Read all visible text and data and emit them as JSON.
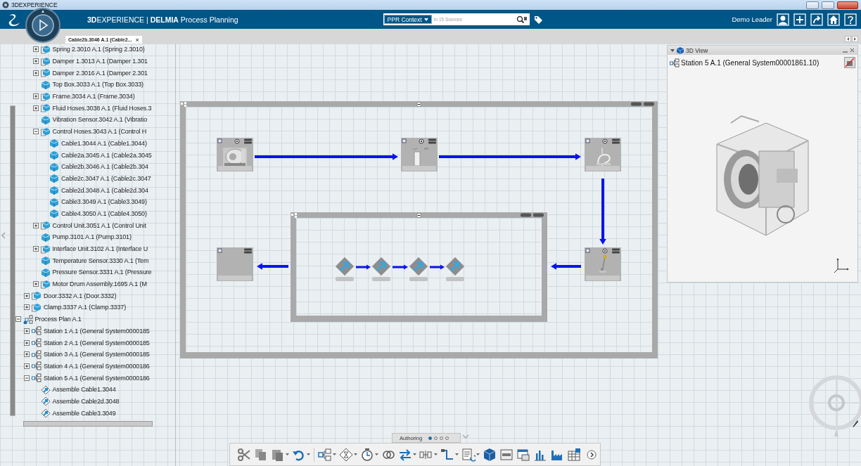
{
  "window": {
    "title": "3DEXPERIENCE"
  },
  "header": {
    "brand": "**3D**EXPERIENCE | **DELMIA** Process Planning",
    "search": {
      "context": "PPR Context",
      "placeholder": "In 15 Sources"
    },
    "user": "Demo Leader"
  },
  "tabs": [
    {
      "label": "Cable2b.3046 A.1 (Cable2...",
      "close": "×",
      "selected": true
    }
  ],
  "tree": {
    "items": [
      {
        "children": [
          {
            "children": [
              {
                "label": "Spring 2.3010 A.1 (Spring 2.3010)",
                "kind": "assembly",
                "expanded": false
              },
              {
                "label": "Damper 1.3013 A.1 (Damper 1.301",
                "kind": "assembly",
                "expanded": false
              },
              {
                "label": "Damper 2.3016 A.1 (Damper 2.301",
                "kind": "assembly",
                "expanded": false
              },
              {
                "label": "Top Box.3033 A.1 (Top Box.3033)",
                "kind": "part"
              },
              {
                "label": "Frame.3034 A.1 (Frame.3034)",
                "kind": "assembly",
                "expanded": false
              },
              {
                "label": "Fluid Hoses.3038 A.1 (Fluid Hoses.3",
                "kind": "assembly",
                "expanded": false
              },
              {
                "label": "Vibration Sensor.3042 A.1 (Vibratio",
                "kind": "part"
              },
              {
                "label": "Control Hoses.3043 A.1 (Control H",
                "kind": "assembly",
                "expanded": true,
                "children": [
                  {
                    "label": "Cable1.3044 A.1 (Cable1.3044)",
                    "kind": "part"
                  },
                  {
                    "label": "Cable2a.3045 A.1 (Cable2a.3045",
                    "kind": "part"
                  },
                  {
                    "label": "Cable2b.3046 A.1 (Cable2b.304",
                    "kind": "part"
                  },
                  {
                    "label": "Cable2c.3047 A.1 (Cable2c.3047",
                    "kind": "part"
                  },
                  {
                    "label": "Cable2d.3048 A.1 (Cable2d.304",
                    "kind": "part"
                  },
                  {
                    "label": "Cable3.3049 A.1 (Cable3.3049)",
                    "kind": "part"
                  },
                  {
                    "label": "Cable4.3050 A.1 (Cable4.3050)",
                    "kind": "part"
                  }
                ]
              },
              {
                "label": "Control Unit.3051 A.1 (Control Unit",
                "kind": "assembly",
                "expanded": false
              },
              {
                "label": "Pump.3101 A.1 (Pump.3101)",
                "kind": "part"
              },
              {
                "label": "Interface Unit.3102 A.1 (Interface U",
                "kind": "assembly",
                "expanded": false
              },
              {
                "label": "Temperature Sensor.3330 A.1 (Tem",
                "kind": "part"
              },
              {
                "label": "Pressure Sensor.3331 A.1 (Pressure",
                "kind": "part"
              },
              {
                "label": "Motor Drum Assembly.1695 A.1 (M",
                "kind": "assembly",
                "expanded": false
              }
            ]
          },
          {
            "label": "Door.3332 A.1 (Door.3332)",
            "kind": "assembly",
            "expanded": false
          },
          {
            "label": "Clamp.3337 A.1 (Clamp.3337)",
            "kind": "assembly",
            "expanded": false
          }
        ]
      },
      {
        "label": "Process Plan A.1",
        "kind": "plan",
        "expanded": true,
        "children": [
          {
            "label": "Station 1 A.1 (General System0000185",
            "kind": "system",
            "expanded": false
          },
          {
            "label": "Station 2 A.1 (General System0000185",
            "kind": "system",
            "expanded": false
          },
          {
            "label": "Station 3 A.1 (General System0000185",
            "kind": "system",
            "expanded": false
          },
          {
            "label": "Station 4 A.1 (General System0000186",
            "kind": "system",
            "expanded": false
          },
          {
            "label": "Station 5 A.1 (General System0000186",
            "kind": "system",
            "expanded": true,
            "children": [
              {
                "label": "Assemble Cable1.3044",
                "kind": "operation"
              },
              {
                "label": "Assemble Cable2d.3048",
                "kind": "operation"
              },
              {
                "label": "Assemble Cable3.3049",
                "kind": "operation"
              }
            ]
          }
        ]
      }
    ]
  },
  "diagram": {
    "stations": [
      {
        "kind": "picture"
      },
      {
        "kind": "picture"
      },
      {
        "kind": "picture"
      },
      {
        "kind": "picture"
      },
      {
        "kind": "empty"
      }
    ],
    "operations": [
      {
        "kind": "operation"
      },
      {
        "kind": "operation"
      },
      {
        "kind": "operation"
      },
      {
        "kind": "operation"
      }
    ]
  },
  "view_panel": {
    "title": "3D View",
    "item": "Station 5 A.1 (General System00001861.10)",
    "expanded": true
  },
  "toolbar": {
    "section": "Authoring",
    "pages": [
      {
        "selected": true
      },
      {
        "selected": false
      },
      {
        "selected": false
      },
      {
        "selected": false
      }
    ],
    "groups": [
      {
        "tools": [
          {
            "menu": false
          },
          {
            "menu": false
          },
          {
            "menu": true
          },
          {
            "menu": true
          }
        ]
      },
      {
        "tools": [
          {
            "menu": true
          },
          {
            "menu": true
          },
          {
            "menu": true
          },
          {
            "menu": false
          },
          {
            "menu": true
          },
          {
            "menu": true
          },
          {
            "menu": true
          },
          {
            "menu": true
          },
          {
            "menu": false
          },
          {
            "menu": false
          },
          {
            "menu": false
          },
          {
            "menu": false
          },
          {
            "menu": false
          },
          {
            "menu": false
          }
        ]
      }
    ]
  }
}
